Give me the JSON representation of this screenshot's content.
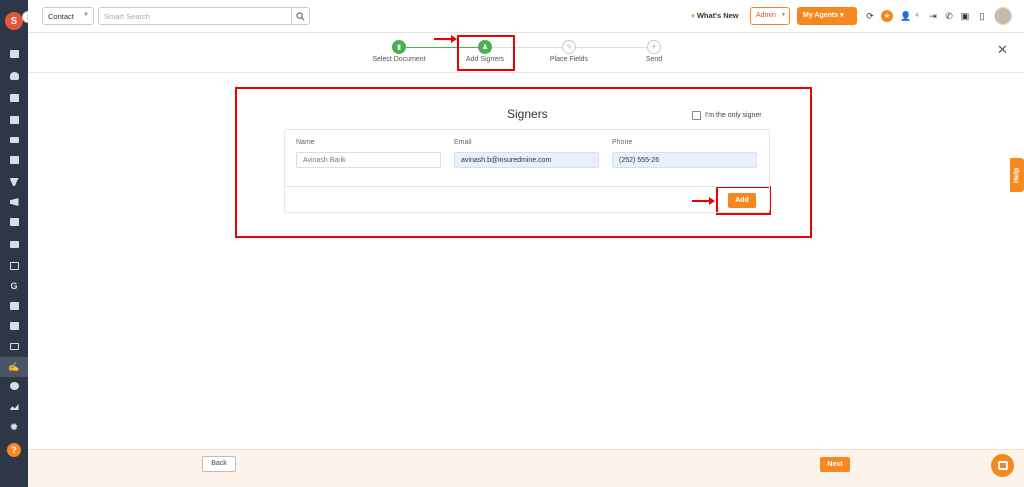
{
  "topbar": {
    "contact_select": "Contact",
    "search_placeholder": "Smart Search",
    "whats_new": "What's New",
    "admin": "Admin",
    "my_agents": "My Agents",
    "notification_count": "4"
  },
  "stepper": {
    "steps": [
      {
        "label": "Select Document",
        "status": "done"
      },
      {
        "label": "Add Signers",
        "status": "done"
      },
      {
        "label": "Place Fields",
        "status": "todo"
      },
      {
        "label": "Send",
        "status": "todo"
      }
    ]
  },
  "signers": {
    "title": "Signers",
    "only_signer_label": "I'm the only signer",
    "only_signer_checked": false,
    "fields": {
      "name_label": "Name",
      "email_label": "Email",
      "phone_label": "Phone",
      "name_value": "Avinash Barik",
      "email_value": "avinash.b@insuredmine.com",
      "phone_value": "(252) 555-26"
    },
    "add_label": "Add"
  },
  "help_tab": "Help",
  "footer": {
    "back_label": "Back",
    "next_label": "Next"
  },
  "colors": {
    "accent": "#f5881f",
    "sidebar": "#2d3748",
    "success": "#4caf50",
    "annotation": "#e00000"
  },
  "icons": [
    "logo-icon",
    "dashboard-icon",
    "contacts-icon",
    "documents-icon",
    "bank-icon",
    "list-icon",
    "contact-card-icon",
    "filter-icon",
    "megaphone-icon",
    "report-icon",
    "chart-icon",
    "folder-icon",
    "google-icon",
    "calculator-icon",
    "calendar-icon",
    "mail-icon",
    "signature-icon",
    "dollar-icon",
    "analytics-icon",
    "settings-icon",
    "help-icon"
  ]
}
